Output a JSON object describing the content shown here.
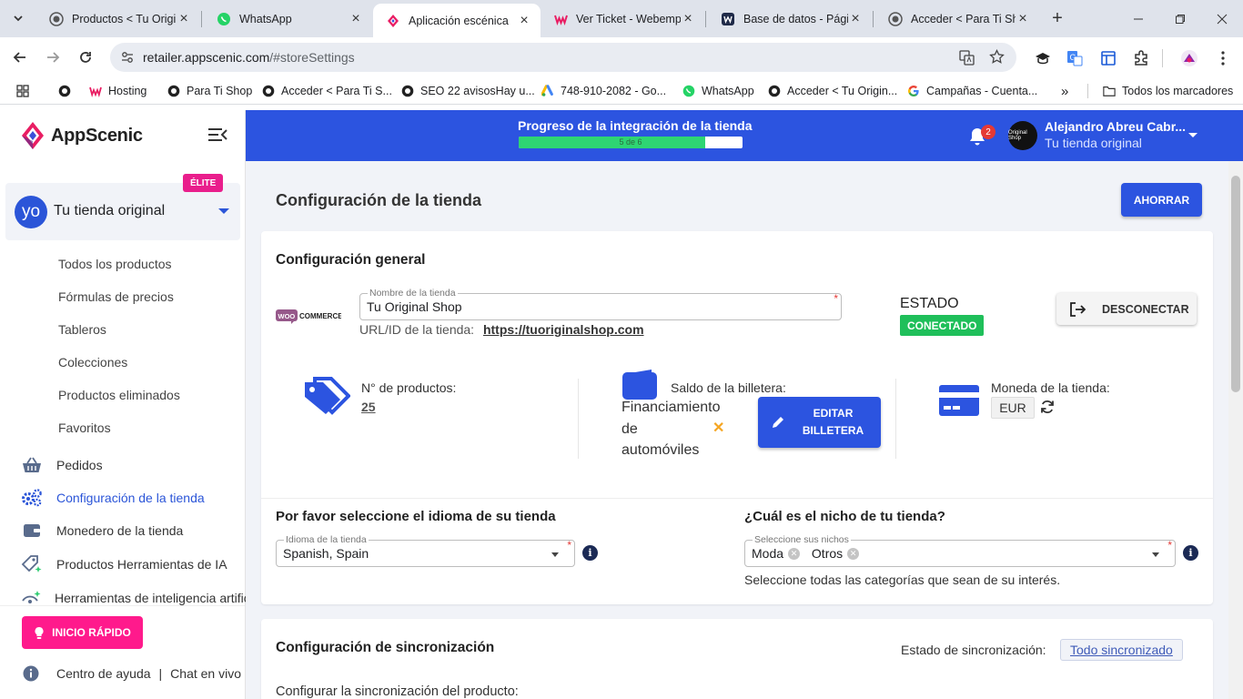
{
  "browser": {
    "tabs": [
      {
        "title": "Productos < Tu Original Shop",
        "icon": "wordpress-icon"
      },
      {
        "title": "WhatsApp",
        "icon": "whatsapp-icon"
      },
      {
        "title": "Aplicación escénica",
        "icon": "appscenic-icon"
      },
      {
        "title": "Ver Ticket - Webempresa",
        "icon": "webempresa-icon"
      },
      {
        "title": "Base de datos - Página",
        "icon": "database-icon"
      },
      {
        "title": "Acceder < Para Ti Shop",
        "icon": "wordpress-icon"
      }
    ],
    "url_host": "retailer.appscenic.com",
    "url_path": "/#storeSettings",
    "bookmarks": [
      {
        "label": "Hosting",
        "icon": "webempresa-icon"
      },
      {
        "label": "Para Ti Shop",
        "icon": "wordpress-icon"
      },
      {
        "label": "Acceder < Para Ti S...",
        "icon": "wordpress-icon"
      },
      {
        "label": "SEO 22 avisosHay u...",
        "icon": "wordpress-icon"
      },
      {
        "label": "748-910-2082 - Go...",
        "icon": "google-ads-icon"
      },
      {
        "label": "WhatsApp",
        "icon": "whatsapp-icon"
      },
      {
        "label": "Acceder < Tu Origin...",
        "icon": "wordpress-icon"
      },
      {
        "label": "Campañas - Cuenta...",
        "icon": "google-icon"
      }
    ],
    "bookmarks_more": "»",
    "all_bookmarks": "Todos los marcadores"
  },
  "app": {
    "brand": "AppScenic",
    "store": {
      "avatar": "yo",
      "name": "Tu tienda original",
      "badge": "ÉLITE"
    },
    "submenu": [
      "Todos los productos",
      "Fórmulas de precios",
      "Tableros",
      "Colecciones",
      "Productos eliminados",
      "Favoritos"
    ],
    "menu": [
      {
        "label": "Pedidos",
        "icon": "basket-icon"
      },
      {
        "label": "Configuración de la tienda",
        "icon": "gears-icon"
      },
      {
        "label": "Monedero de la tienda",
        "icon": "wallet-icon"
      },
      {
        "label": "Productos Herramientas de IA",
        "icon": "ai-tag-icon"
      },
      {
        "label": "Herramientas de inteligencia artificial",
        "icon": "ai-tools-icon"
      }
    ],
    "quick_start": "INICIO RÁPIDO",
    "help": "Centro de ayuda",
    "help_sep": "|",
    "chat": "Chat en vivo",
    "progress": {
      "title": "Progreso de la integración de la tienda",
      "label": "5 de 6",
      "value": 0.833
    },
    "notifications": "2",
    "user": {
      "avatar": "Original Shop",
      "name": "Alejandro Abreu Cabr...",
      "store": "Tu tienda original"
    }
  },
  "page": {
    "title": "Configuración de la tienda",
    "save": "AHORRAR",
    "general": {
      "title": "Configuración general",
      "platform": "WOOCOMMERCE",
      "store_name_label": "Nombre de la tienda",
      "store_name": "Tu Original Shop",
      "url_label": "URL/ID de la tienda:",
      "url": "https://tuoriginalshop.com",
      "status_label": "ESTADO",
      "status": "CONECTADO",
      "disconnect": "DESCONECTAR",
      "products_label": "N° de productos:",
      "products_count": "25",
      "wallet_label": "Saldo de la billetera:",
      "wallet_line1": "Financiamiento",
      "wallet_line2": "de",
      "wallet_line3": "automóviles",
      "edit_wallet_1": "EDITAR",
      "edit_wallet_2": "BILLETERA",
      "currency_label": "Moneda de la tienda:",
      "currency": "EUR",
      "language_title": "Por favor seleccione el idioma de su tienda",
      "language_label": "Idioma de la tienda",
      "language": "Spanish, Spain",
      "niche_title": "¿Cuál es el nicho de tu tienda?",
      "niche_label": "Seleccione sus nichos",
      "niches": [
        "Moda",
        "Otros"
      ],
      "niche_help": "Seleccione todas las categorías que sean de su interés."
    },
    "sync": {
      "title": "Configuración de sincronización",
      "status_label": "Estado de sincronización:",
      "status": "Todo sincronizado",
      "product_sync": "Configurar la sincronización del producto:"
    }
  },
  "colors": {
    "primary": "#2c54e0",
    "accent": "#ff1a8c",
    "success": "#1fbf5a",
    "warning": "#f5a623"
  }
}
